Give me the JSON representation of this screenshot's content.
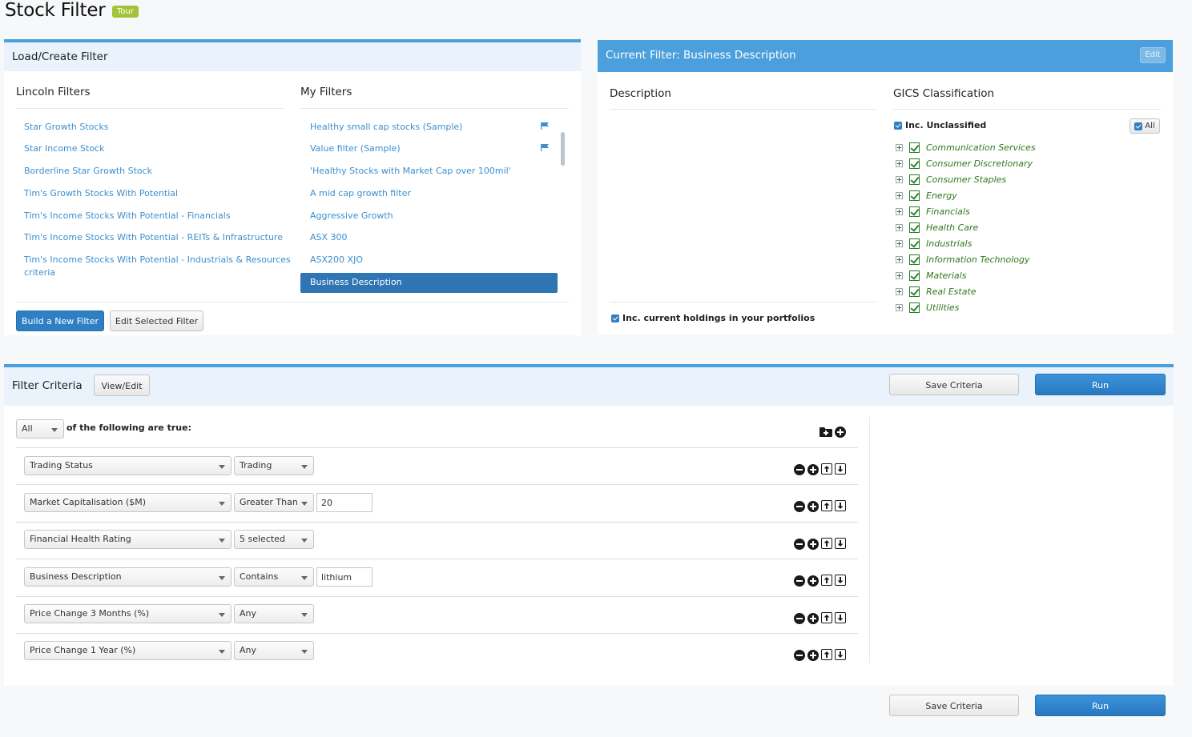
{
  "page": {
    "title": "Stock Filter",
    "tour": "Tour"
  },
  "load_panel": {
    "title": "Load/Create Filter",
    "lincoln_title": "Lincoln Filters",
    "my_title": "My Filters",
    "lincoln_filters": [
      "Star Growth Stocks",
      "Star Income Stock",
      "Borderline Star Growth Stock",
      "Tim's Growth Stocks With Potential",
      "Tim's Income Stocks With Potential - Financials",
      "Tim's Income Stocks With Potential - REITs & Infrastructure",
      "Tim's Income Stocks With Potential - Industrials & Resources",
      "criteria"
    ],
    "my_filters": [
      "Healthy small cap stocks (Sample)",
      "Value filter (Sample)",
      "'Healthy Stocks with Market Cap over 100mil'",
      "A mid cap growth filter",
      "Aggressive Growth",
      "ASX 300",
      "ASX200 XJO"
    ],
    "selected_filter": "Business Description",
    "build_button": "Build a New Filter",
    "edit_button": "Edit Selected Filter"
  },
  "current_panel": {
    "title": "Current Filter: Business Description",
    "edit": "Edit",
    "description_title": "Description",
    "gics_title": "GICS Classification",
    "inc_unclassified": "Inc. Unclassified",
    "all": "All",
    "gics_sectors": [
      "Communication Services",
      "Consumer Discretionary",
      "Consumer Staples",
      "Energy",
      "Financials",
      "Health Care",
      "Industrials",
      "Information Technology",
      "Materials",
      "Real Estate",
      "Utilities"
    ],
    "inc_holdings": "Inc. current holdings in your portfolios"
  },
  "criteria_panel": {
    "title": "Filter Criteria",
    "view_edit": "View/Edit",
    "save": "Save Criteria",
    "run": "Run",
    "match_mode": "All",
    "match_suffix": "of the following are true:",
    "rows": [
      {
        "field": "Trading Status",
        "operator": "Trading",
        "value": null
      },
      {
        "field": "Market Capitalisation ($M)",
        "operator": "Greater Than",
        "value": "20"
      },
      {
        "field": "Financial Health Rating",
        "operator": "5 selected",
        "value": null
      },
      {
        "field": "Business Description",
        "operator": "Contains",
        "value": "lithium"
      },
      {
        "field": "Price Change 3 Months (%)",
        "operator": "Any",
        "value": null
      },
      {
        "field": "Price Change 1 Year (%)",
        "operator": "Any",
        "value": null
      }
    ]
  },
  "footer": {
    "save": "Save Criteria",
    "run": "Run"
  },
  "colors": {
    "accent": "#4a9fdc",
    "link": "#3b8fcf",
    "selected": "#2f74b3",
    "gics_green": "#2f7a1a",
    "tour": "#a4c23a"
  }
}
